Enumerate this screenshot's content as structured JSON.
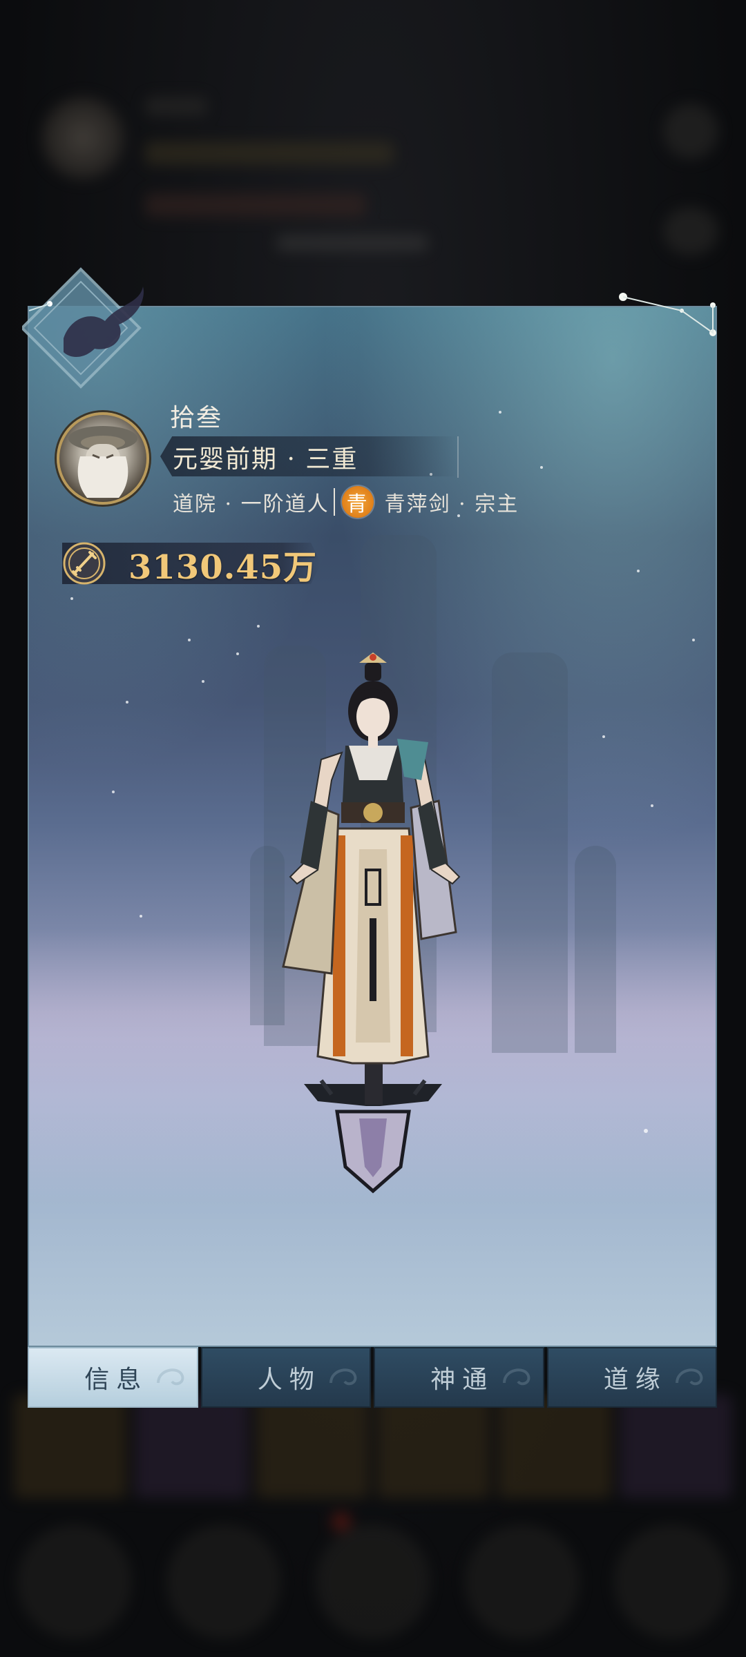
{
  "player": {
    "name": "拾叁",
    "realm": "元婴前期 · 三重",
    "school_rank": "道院 · 一阶道人",
    "grade_badge": "青",
    "sect_role": "青萍剑 · 宗主",
    "power": "3130.45万"
  },
  "icons": {
    "emblem": "fox-emblem-icon",
    "constellation": "constellation-icon",
    "power": "sword-power-icon",
    "avatar": "elder-avatar"
  },
  "colors": {
    "power_text": "#f1c879",
    "grade_badge": "#e98a22",
    "tab_active_bg": "#c9dbe7",
    "tab_inactive_bg": "#2a4357"
  },
  "tabs": [
    {
      "label": "信息",
      "active": true
    },
    {
      "label": "人物",
      "active": false
    },
    {
      "label": "神通",
      "active": false
    },
    {
      "label": "道缘",
      "active": false
    }
  ]
}
